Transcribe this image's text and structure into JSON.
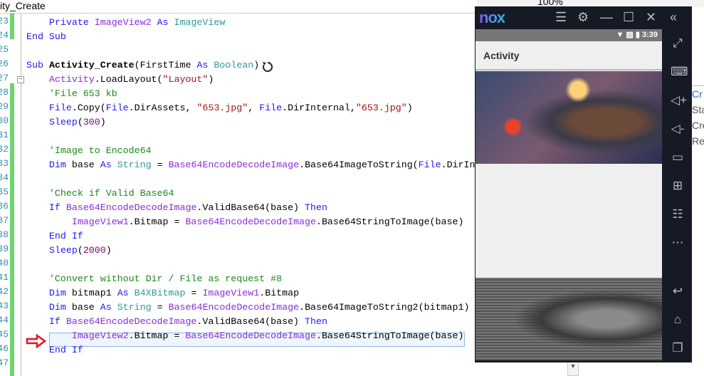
{
  "tab": {
    "title": "ity_Create"
  },
  "toolbar": {
    "zoom": "100%"
  },
  "editor": {
    "line_numbers": [
      "23",
      "24",
      "25",
      "26",
      "27",
      "28",
      "29",
      "30",
      "31",
      "32",
      "33",
      "34",
      "35",
      "36",
      "37",
      "38",
      "39",
      "40",
      "41",
      "42",
      "43",
      "44",
      "45",
      "46",
      "47"
    ],
    "lines": [
      [
        [
          "    ",
          ""
        ],
        [
          "Private",
          "kw"
        ],
        [
          " ",
          ""
        ],
        [
          "ImageView2",
          "id"
        ],
        [
          " ",
          ""
        ],
        [
          "As",
          "kw"
        ],
        [
          " ",
          ""
        ],
        [
          "ImageView",
          "ty"
        ]
      ],
      [
        [
          "End Sub",
          "kw"
        ]
      ],
      [],
      [
        [
          "Sub",
          "kw"
        ],
        [
          " ",
          ""
        ],
        [
          "Activity_Create",
          "b"
        ],
        [
          "(FirstTime ",
          ""
        ],
        [
          "As",
          "kw"
        ],
        [
          " ",
          ""
        ],
        [
          "Boolean",
          "ty"
        ],
        [
          ")",
          ""
        ]
      ],
      [
        [
          "    ",
          ""
        ],
        [
          "Activity",
          "id"
        ],
        [
          ".LoadLayout(",
          ""
        ],
        [
          "\"Layout\"",
          "st"
        ],
        [
          ")",
          ""
        ]
      ],
      [
        [
          "    ",
          ""
        ],
        [
          "'File 653 kb",
          "cm"
        ]
      ],
      [
        [
          "    ",
          ""
        ],
        [
          "File",
          "kw"
        ],
        [
          ".Copy(",
          ""
        ],
        [
          "File",
          "kw"
        ],
        [
          ".DirAssets, ",
          ""
        ],
        [
          "\"653.jpg\"",
          "st"
        ],
        [
          ", ",
          ""
        ],
        [
          "File",
          "kw"
        ],
        [
          ".DirInternal,",
          ""
        ],
        [
          "\"653.jpg\"",
          "st"
        ],
        [
          ")",
          ""
        ]
      ],
      [
        [
          "    ",
          ""
        ],
        [
          "Sleep",
          "kw"
        ],
        [
          "(",
          ""
        ],
        [
          "300",
          "nu"
        ],
        [
          ")",
          ""
        ]
      ],
      [],
      [
        [
          "    ",
          ""
        ],
        [
          "'Image to Encode64",
          "cm"
        ]
      ],
      [
        [
          "    ",
          ""
        ],
        [
          "Dim",
          "kw"
        ],
        [
          " base ",
          ""
        ],
        [
          "As",
          "kw"
        ],
        [
          " ",
          ""
        ],
        [
          "String",
          "ty"
        ],
        [
          " = ",
          ""
        ],
        [
          "Base64EncodeDecodeImage",
          "id"
        ],
        [
          ".Base64ImageToString(",
          ""
        ],
        [
          "File",
          "kw"
        ],
        [
          ".DirIn",
          ""
        ]
      ],
      [],
      [
        [
          "    ",
          ""
        ],
        [
          "'Check if Valid Base64",
          "cm"
        ]
      ],
      [
        [
          "    ",
          ""
        ],
        [
          "If",
          "kw"
        ],
        [
          " ",
          ""
        ],
        [
          "Base64EncodeDecodeImage",
          "id"
        ],
        [
          ".ValidBase64(base) ",
          ""
        ],
        [
          "Then",
          "kw"
        ]
      ],
      [
        [
          "        ",
          ""
        ],
        [
          "ImageView1",
          "id"
        ],
        [
          ".Bitmap = ",
          ""
        ],
        [
          "Base64EncodeDecodeImage",
          "id"
        ],
        [
          ".Base64StringToImage(base)",
          ""
        ]
      ],
      [
        [
          "    ",
          ""
        ],
        [
          "End If",
          "kw"
        ]
      ],
      [
        [
          "    ",
          ""
        ],
        [
          "Sleep",
          "kw"
        ],
        [
          "(",
          ""
        ],
        [
          "2000",
          "nu"
        ],
        [
          ")",
          ""
        ]
      ],
      [],
      [
        [
          "    ",
          ""
        ],
        [
          "'Convert without Dir / File as request #8",
          "cm"
        ]
      ],
      [
        [
          "    ",
          ""
        ],
        [
          "Dim",
          "kw"
        ],
        [
          " bitmap1 ",
          ""
        ],
        [
          "As",
          "kw"
        ],
        [
          " ",
          ""
        ],
        [
          "B4XBitmap",
          "ty"
        ],
        [
          " = ",
          ""
        ],
        [
          "ImageView1",
          "id"
        ],
        [
          ".Bitmap",
          ""
        ]
      ],
      [
        [
          "    ",
          ""
        ],
        [
          "Dim",
          "kw"
        ],
        [
          " base ",
          ""
        ],
        [
          "As",
          "kw"
        ],
        [
          " ",
          ""
        ],
        [
          "String",
          "ty"
        ],
        [
          " = ",
          ""
        ],
        [
          "Base64EncodeDecodeImage",
          "id"
        ],
        [
          ".Base64ImageToString2(bitmap1)",
          ""
        ]
      ],
      [
        [
          "    ",
          ""
        ],
        [
          "If",
          "kw"
        ],
        [
          " ",
          ""
        ],
        [
          "Base64EncodeDecodeImage",
          "id"
        ],
        [
          ".ValidBase64(base) ",
          ""
        ],
        [
          "Then",
          "kw"
        ]
      ],
      [
        [
          "        ",
          ""
        ],
        [
          "ImageView2",
          "id"
        ],
        [
          ".Bitmap = ",
          ""
        ],
        [
          "Base64EncodeDecodeImage",
          "id"
        ],
        [
          ".Base64StringToImage(base)",
          ""
        ]
      ],
      [
        [
          "    ",
          ""
        ],
        [
          "End If",
          "kw"
        ]
      ],
      []
    ]
  },
  "emulator": {
    "logo": "nox",
    "time": "3:39",
    "app_title": "Activity"
  },
  "right_panel": {
    "items": [
      "Cr",
      "Sta",
      "Crea",
      "Res"
    ]
  },
  "colors": {
    "highlight": "#eef5fc",
    "arrow": "#e8151b",
    "gutter": "#6fd66f"
  }
}
